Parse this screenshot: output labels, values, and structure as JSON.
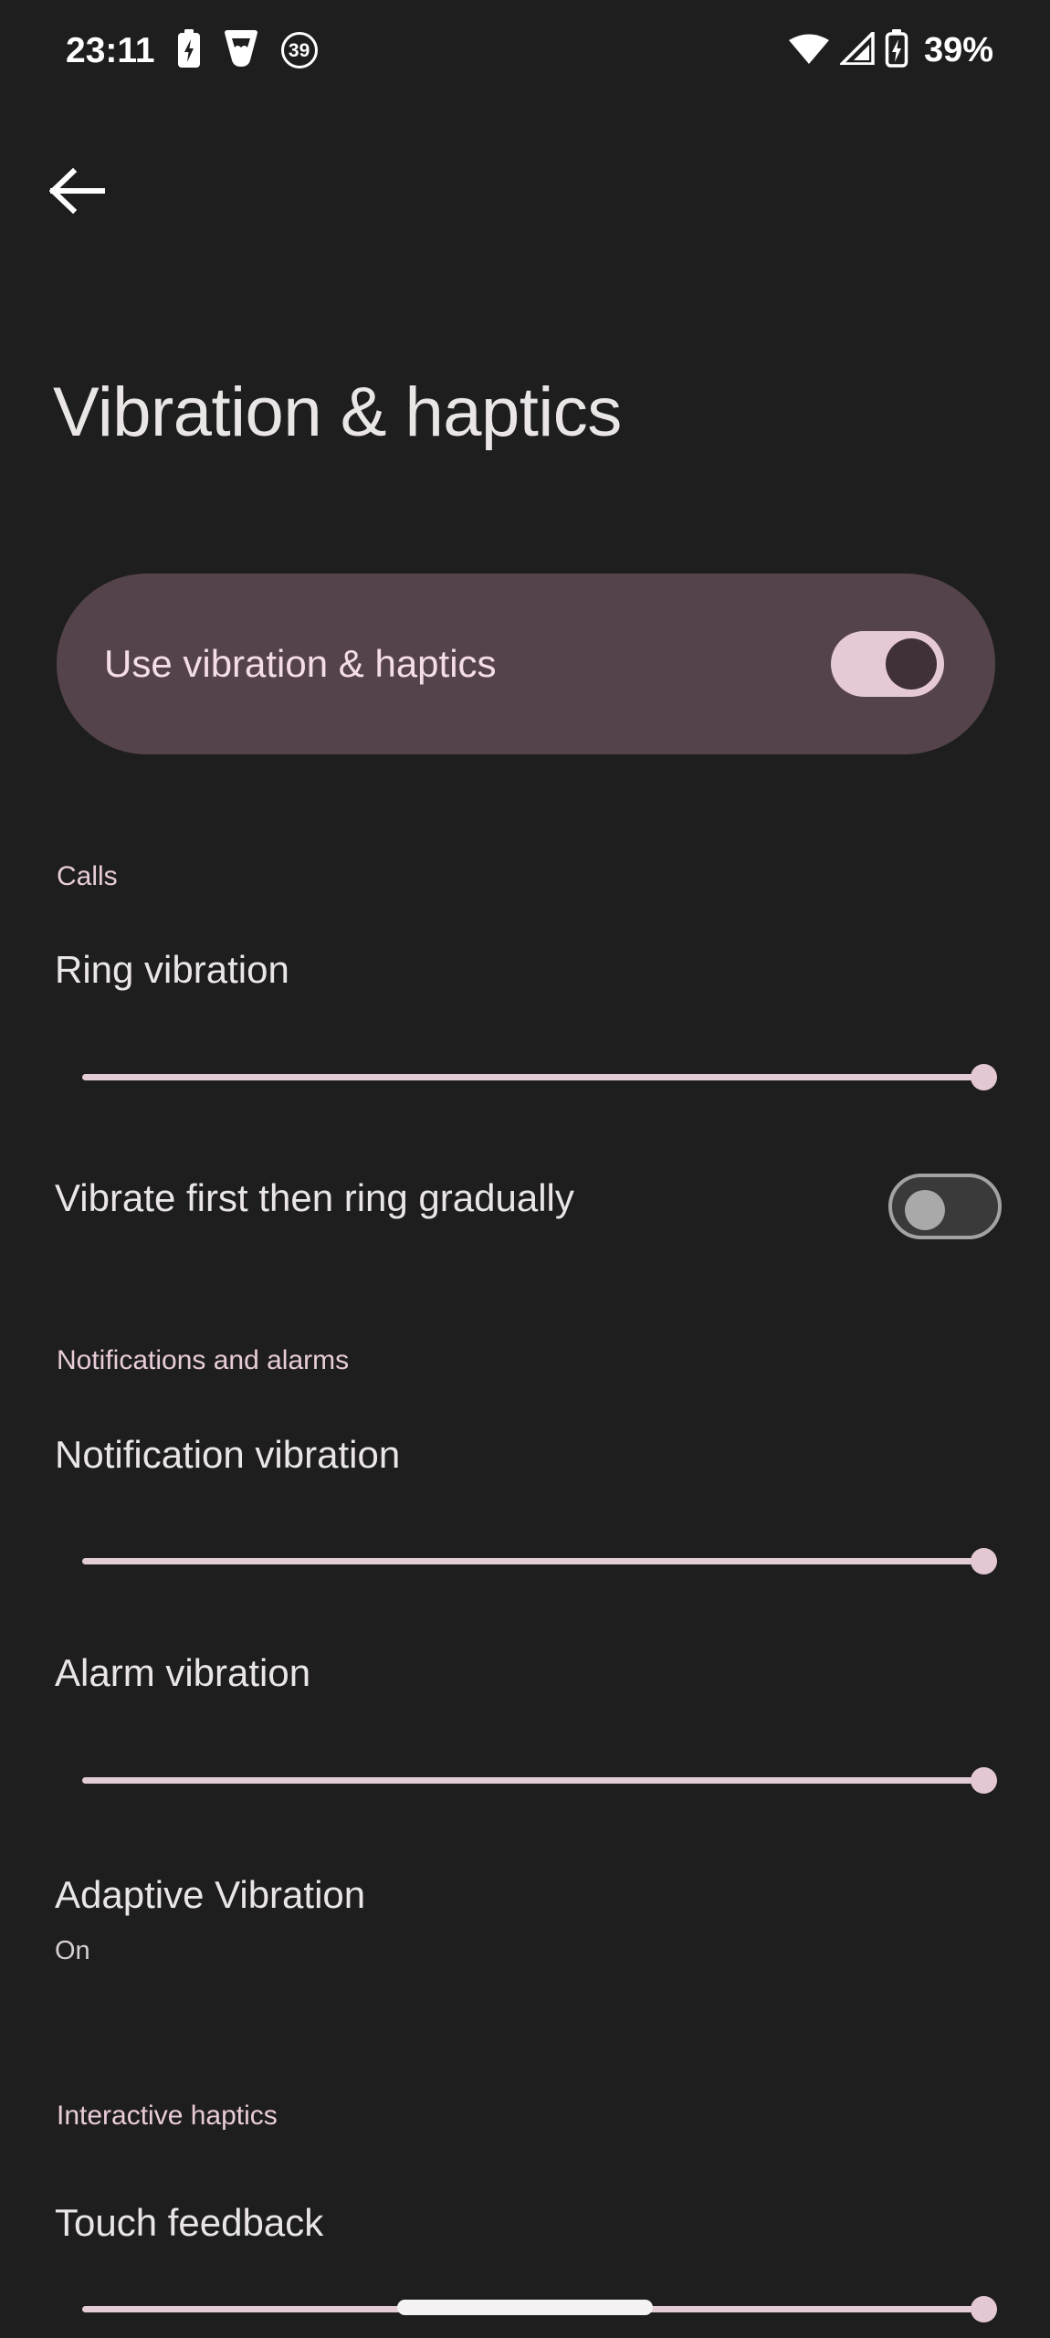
{
  "status_bar": {
    "time": "23:11",
    "battery_percent": "39%",
    "left_icons": [
      {
        "name": "battery-charging-icon"
      },
      {
        "name": "shield-icon"
      },
      {
        "name": "battery-countdown-icon",
        "value": "39"
      }
    ],
    "right_icons": [
      {
        "name": "wifi-icon"
      },
      {
        "name": "cellular-signal-icon"
      },
      {
        "name": "battery-charging-icon"
      }
    ]
  },
  "nav": {
    "back_icon": "arrow-left-icon"
  },
  "header": {
    "title": "Vibration & haptics"
  },
  "master_toggle": {
    "label": "Use vibration & haptics",
    "state": "on"
  },
  "sections": [
    {
      "header": "Calls",
      "items": [
        {
          "type": "slider",
          "title": "Ring vibration",
          "value": 100,
          "min": 0,
          "max": 100
        },
        {
          "type": "switch",
          "title": "Vibrate first then ring gradually",
          "state": "off"
        }
      ]
    },
    {
      "header": "Notifications and alarms",
      "items": [
        {
          "type": "slider",
          "title": "Notification vibration",
          "value": 100,
          "min": 0,
          "max": 100
        },
        {
          "type": "slider",
          "title": "Alarm vibration",
          "value": 100,
          "min": 0,
          "max": 100
        },
        {
          "type": "link",
          "title": "Adaptive Vibration",
          "subtitle": "On"
        }
      ]
    },
    {
      "header": "Interactive haptics",
      "items": [
        {
          "type": "slider",
          "title": "Touch feedback",
          "value": 100,
          "min": 0,
          "max": 100
        }
      ]
    }
  ],
  "colors": {
    "background": "#1f1e1e",
    "card": "#55434c",
    "accent_pink": "#e3ccd6",
    "accent_text": "#f4dde6",
    "section_header": "#e8ccd9",
    "primary_text": "#eae6e6"
  }
}
